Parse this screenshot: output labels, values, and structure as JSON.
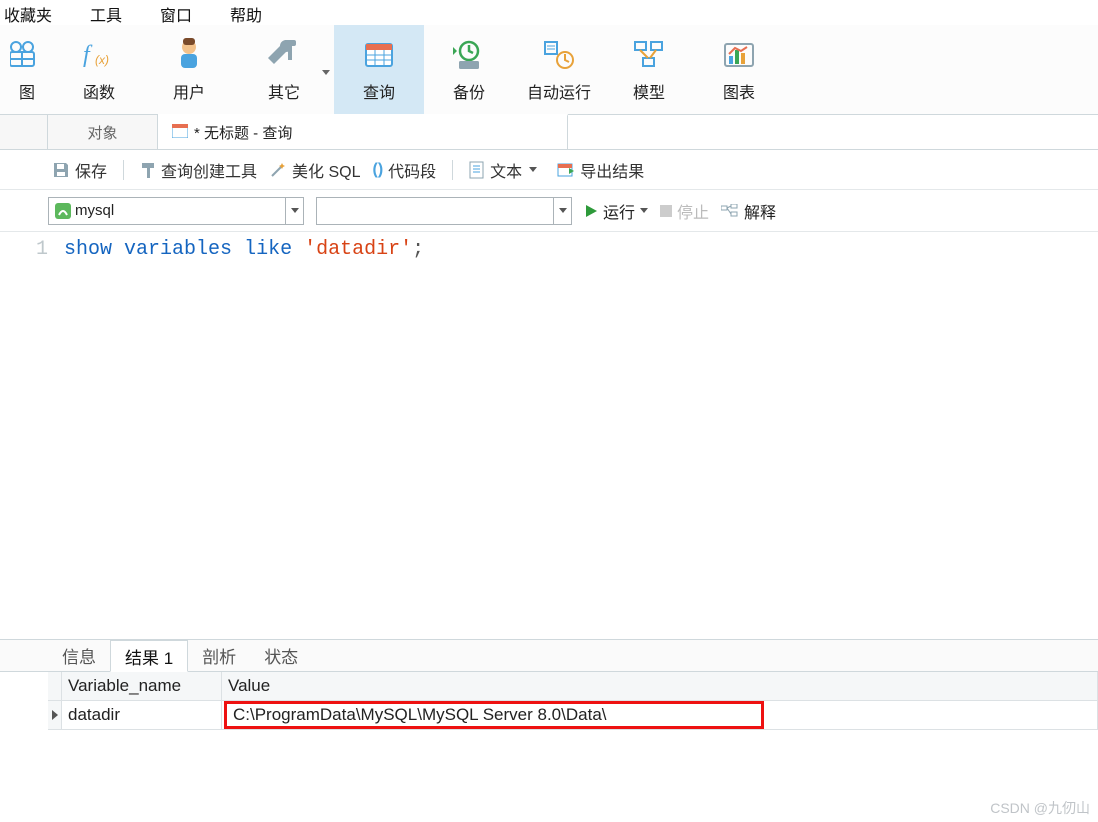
{
  "menu": {
    "favorites": "收藏夹",
    "tools": "工具",
    "window": "窗口",
    "help": "帮助"
  },
  "ribbon": {
    "view": "图",
    "function": "函数",
    "user": "用户",
    "other": "其它",
    "query": "查询",
    "backup": "备份",
    "autorun": "自动运行",
    "model": "模型",
    "chart": "图表"
  },
  "tabs": {
    "objects": "对象",
    "untitled": "* 无标题 - 查询"
  },
  "toolbar2": {
    "save": "保存",
    "query_builder": "查询创建工具",
    "beautify": "美化 SQL",
    "snippet": "代码段",
    "text": "文本",
    "export": "导出结果"
  },
  "toolbar3": {
    "connection": "mysql",
    "db_placeholder": "",
    "run": "运行",
    "stop": "停止",
    "explain": "解释"
  },
  "editor": {
    "line_no": "1",
    "kw1": "show",
    "kw2": "variables",
    "kw3": "like",
    "str": "'datadir'",
    "semi": ";"
  },
  "bottom_tabs": {
    "info": "信息",
    "result": "结果 1",
    "profile": "剖析",
    "status": "状态"
  },
  "grid": {
    "col_name": "Variable_name",
    "col_value": "Value",
    "row1_name": "datadir",
    "row1_value": "C:\\ProgramData\\MySQL\\MySQL Server 8.0\\Data\\"
  },
  "watermark": "CSDN @九仞山"
}
